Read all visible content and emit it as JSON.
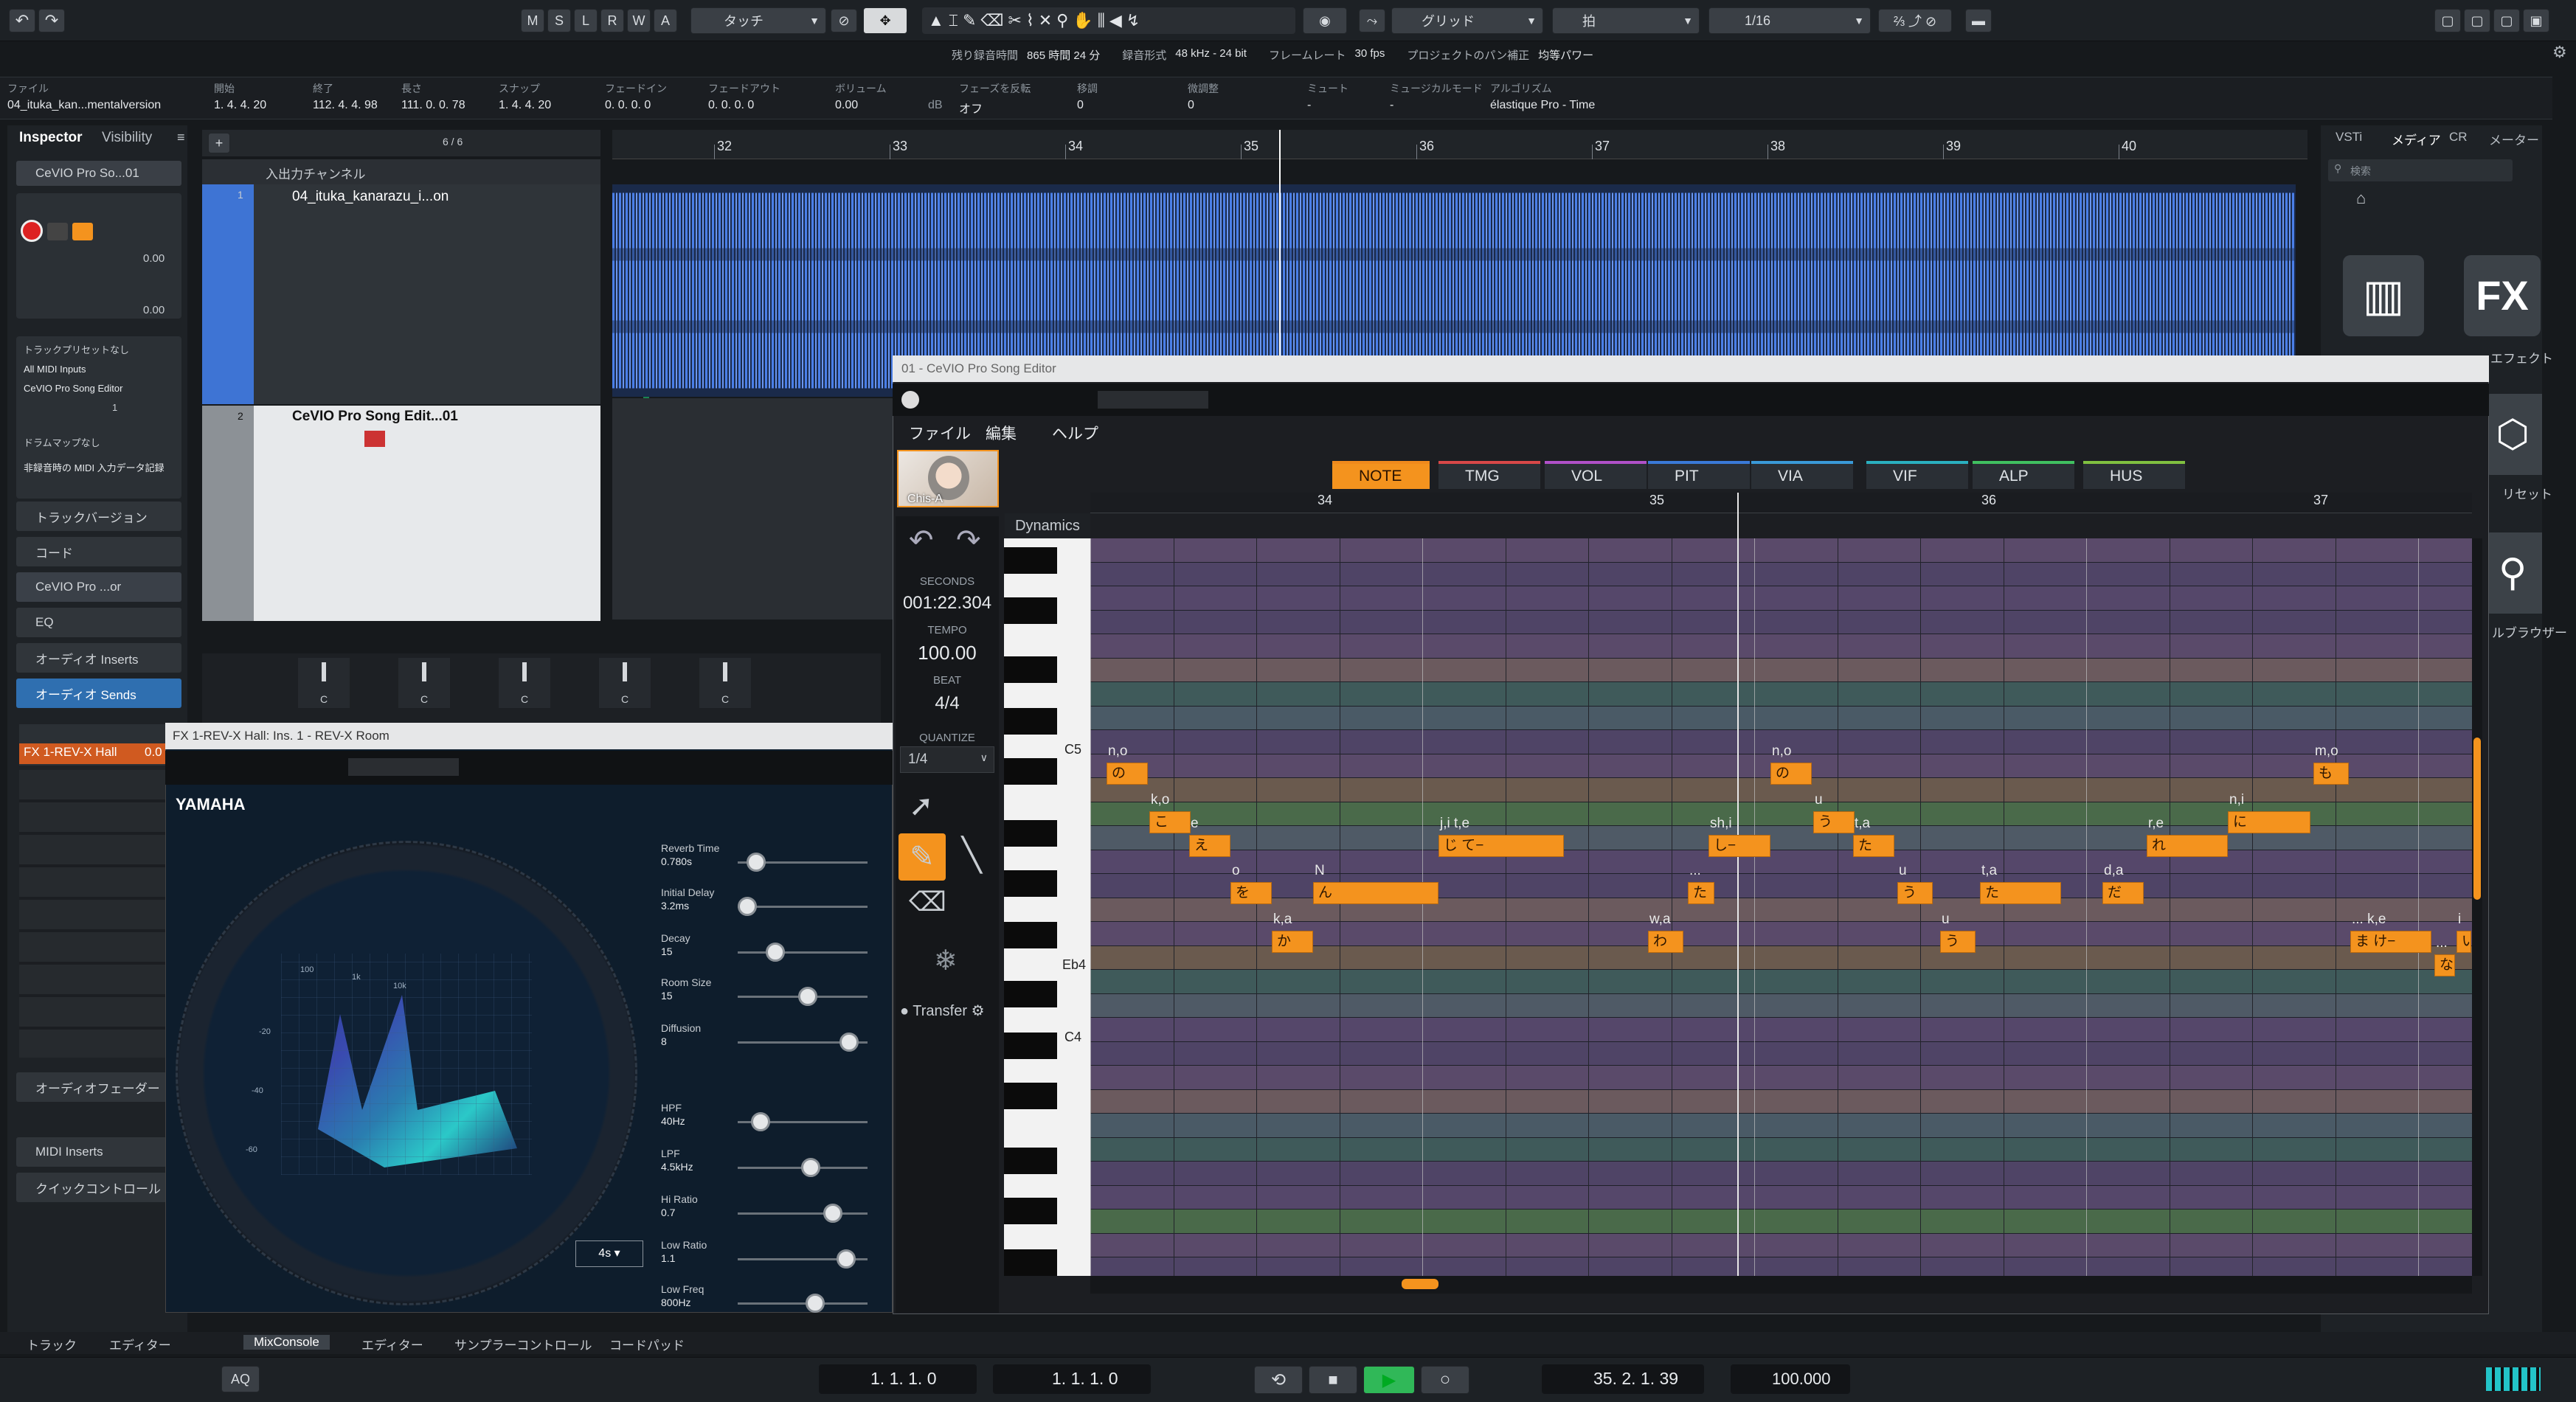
{
  "toolbar": {
    "msr": [
      "M",
      "S",
      "L",
      "R",
      "W",
      "A"
    ],
    "automation_mode": "タッチ",
    "snap_type": "グリッド",
    "grid_type": "拍",
    "quantize": "1/16"
  },
  "status": {
    "rec_time_label": "残り録音時間",
    "rec_time": "865 時間 24 分",
    "rec_format_label": "録音形式",
    "rec_format": "48 kHz - 24 bit",
    "framerate_label": "フレームレート",
    "framerate": "30 fps",
    "pan_label": "プロジェクトのパン補正",
    "pan": "均等パワー"
  },
  "infoline": {
    "headers": [
      "ファイル",
      "開始",
      "終了",
      "長さ",
      "スナップ",
      "フェードイン",
      "フェードアウト",
      "ボリューム",
      "フェーズを反転",
      "移調",
      "微調整",
      "ミュート",
      "ミュージカルモード",
      "アルゴリズム"
    ],
    "values": [
      "04_ituka_kan...mentalversion",
      "1. 4. 4. 20",
      "112. 4. 4. 98",
      "111. 0. 0. 78",
      "1. 4. 4. 20",
      "0. 0. 0. 0",
      "0. 0. 0. 0",
      "0.00",
      "オフ",
      "0",
      "0",
      "-",
      "-",
      "élastique Pro - Time"
    ],
    "vol_unit": "dB"
  },
  "inspector": {
    "tab1": "Inspector",
    "tab2": "Visibility",
    "track_name": "CeVIO Pro So...01",
    "vol": "0.00",
    "pan": "0.00",
    "preset": "トラックプリセットなし",
    "midi_in": "All MIDI Inputs",
    "midi_out": "CeVIO Pro Song Editor",
    "ch": "1",
    "drum": "ドラムマップなし",
    "midi_rec": "非録音時の MIDI 入力データ記録",
    "sections": [
      "トラックバージョン",
      "コード",
      "CeVIO Pro ...or",
      "EQ",
      "オーディオ Inserts",
      "オーディオ Sends",
      "オーディオフェーダー",
      "MIDI Inserts",
      "クイックコントロール"
    ],
    "send": "FX 1-REV-X Hall",
    "send_val": "0.0"
  },
  "tracklist": {
    "counter": "6 / 6",
    "folder": "入出力チャンネル",
    "track1": "04_ituka_kanarazu_i...on",
    "track2": "CeVIO Pro Song Edit...01",
    "num1": "1",
    "num2": "2"
  },
  "ruler": [
    "32",
    "33",
    "34",
    "35",
    "36",
    "37",
    "38",
    "39",
    "40"
  ],
  "mixer_knobs": [
    "C",
    "C",
    "C",
    "C",
    "C"
  ],
  "rightzone": {
    "tabs": [
      "VSTi",
      "メディア",
      "CR",
      "メーター"
    ],
    "search": "検索",
    "fx": "FX",
    "fx_label": "エフェクト",
    "preset_label": "リセット",
    "browser_label": "ルブラウザー"
  },
  "cevio": {
    "title": "01 - CeVIO Pro Song Editor",
    "menu": [
      "ファイル",
      "編集",
      "ヘルプ"
    ],
    "singer": "Chis-A",
    "dynamics": "Dynamics",
    "seconds_label": "SECONDS",
    "seconds": "001:22.304",
    "tempo_label": "TEMPO",
    "tempo": "100.00",
    "beat_label": "BEAT",
    "beat": "4/4",
    "quantize_label": "QUANTIZE",
    "quantize": "1/4",
    "transfer": "Transfer",
    "tabs": [
      "NOTE",
      "TMG",
      "VOL",
      "PIT",
      "VIA",
      "VIF",
      "ALP",
      "HUS"
    ],
    "tab_colors": [
      "#f08a1c",
      "#d84848",
      "#b050c8",
      "#3a7ad8",
      "#3a9ad8",
      "#2ab0c0",
      "#40c060",
      "#80c040"
    ],
    "measures": [
      "34",
      "35",
      "36",
      "37"
    ],
    "key_labels": [
      "C5",
      "Eb4",
      "C4"
    ],
    "lyrics": [
      {
        "t": "n,o",
        "n": "の"
      },
      {
        "t": "k,o",
        "n": "こ"
      },
      {
        "t": "e",
        "n": "え"
      },
      {
        "t": "o",
        "n": "を"
      },
      {
        "t": "k,a",
        "n": "か"
      },
      {
        "t": "N",
        "n": "ん"
      },
      {
        "t": "j,i t,e",
        "n": "じ て−"
      },
      {
        "t": "sh,i",
        "n": "し−"
      },
      {
        "t": "...",
        "n": "た"
      },
      {
        "t": "w,a",
        "n": "わ"
      },
      {
        "t": "n,o",
        "n": "の"
      },
      {
        "t": "u",
        "n": "う"
      },
      {
        "t": "t,a",
        "n": "た"
      },
      {
        "t": "u",
        "n": "う"
      },
      {
        "t": "t,a",
        "n": "た"
      },
      {
        "t": "u",
        "n": "う"
      },
      {
        "t": "d,a",
        "n": "だ"
      },
      {
        "t": "r,e",
        "n": "れ"
      },
      {
        "t": "n,i",
        "n": "に"
      },
      {
        "t": "m,o",
        "n": "も"
      },
      {
        "t": "... k,e",
        "n": "ま け−"
      },
      {
        "t": "...",
        "n": "な"
      },
      {
        "t": "i",
        "n": "い"
      }
    ]
  },
  "revx": {
    "title": "FX 1-REV-X Hall: Ins. 1 - REV-X Room",
    "brand": "YAMAHA",
    "params": [
      {
        "name": "Reverb Time",
        "value": "0.780s"
      },
      {
        "name": "Initial Delay",
        "value": "3.2ms"
      },
      {
        "name": "Decay",
        "value": "15"
      },
      {
        "name": "Room Size",
        "value": "15"
      },
      {
        "name": "Diffusion",
        "value": "8"
      },
      {
        "name": "HPF",
        "value": "40Hz"
      },
      {
        "name": "LPF",
        "value": "4.5kHz"
      },
      {
        "name": "Hi Ratio",
        "value": "0.7"
      },
      {
        "name": "Low Ratio",
        "value": "1.1"
      },
      {
        "name": "Low Freq",
        "value": "800Hz"
      }
    ],
    "time_select": "4s",
    "graph_ticks": [
      "100",
      "1k",
      "10k",
      "-20",
      "-40",
      "-60"
    ]
  },
  "bottom_tabs": [
    "トラック",
    "エディター",
    "MixConsole",
    "エディター",
    "サンプラーコントロール",
    "コードパッド"
  ],
  "transport": {
    "left_locator": "1. 1. 1. 0",
    "right_locator": "1. 1. 1. 0",
    "position": "35. 2. 1. 39",
    "tempo": "100.000",
    "aq": "AQ"
  },
  "colors": {
    "accent": "#f4931e",
    "track_blue": "#3e74d4",
    "waveform": "#4a7fe8",
    "bg": "#16191c"
  }
}
